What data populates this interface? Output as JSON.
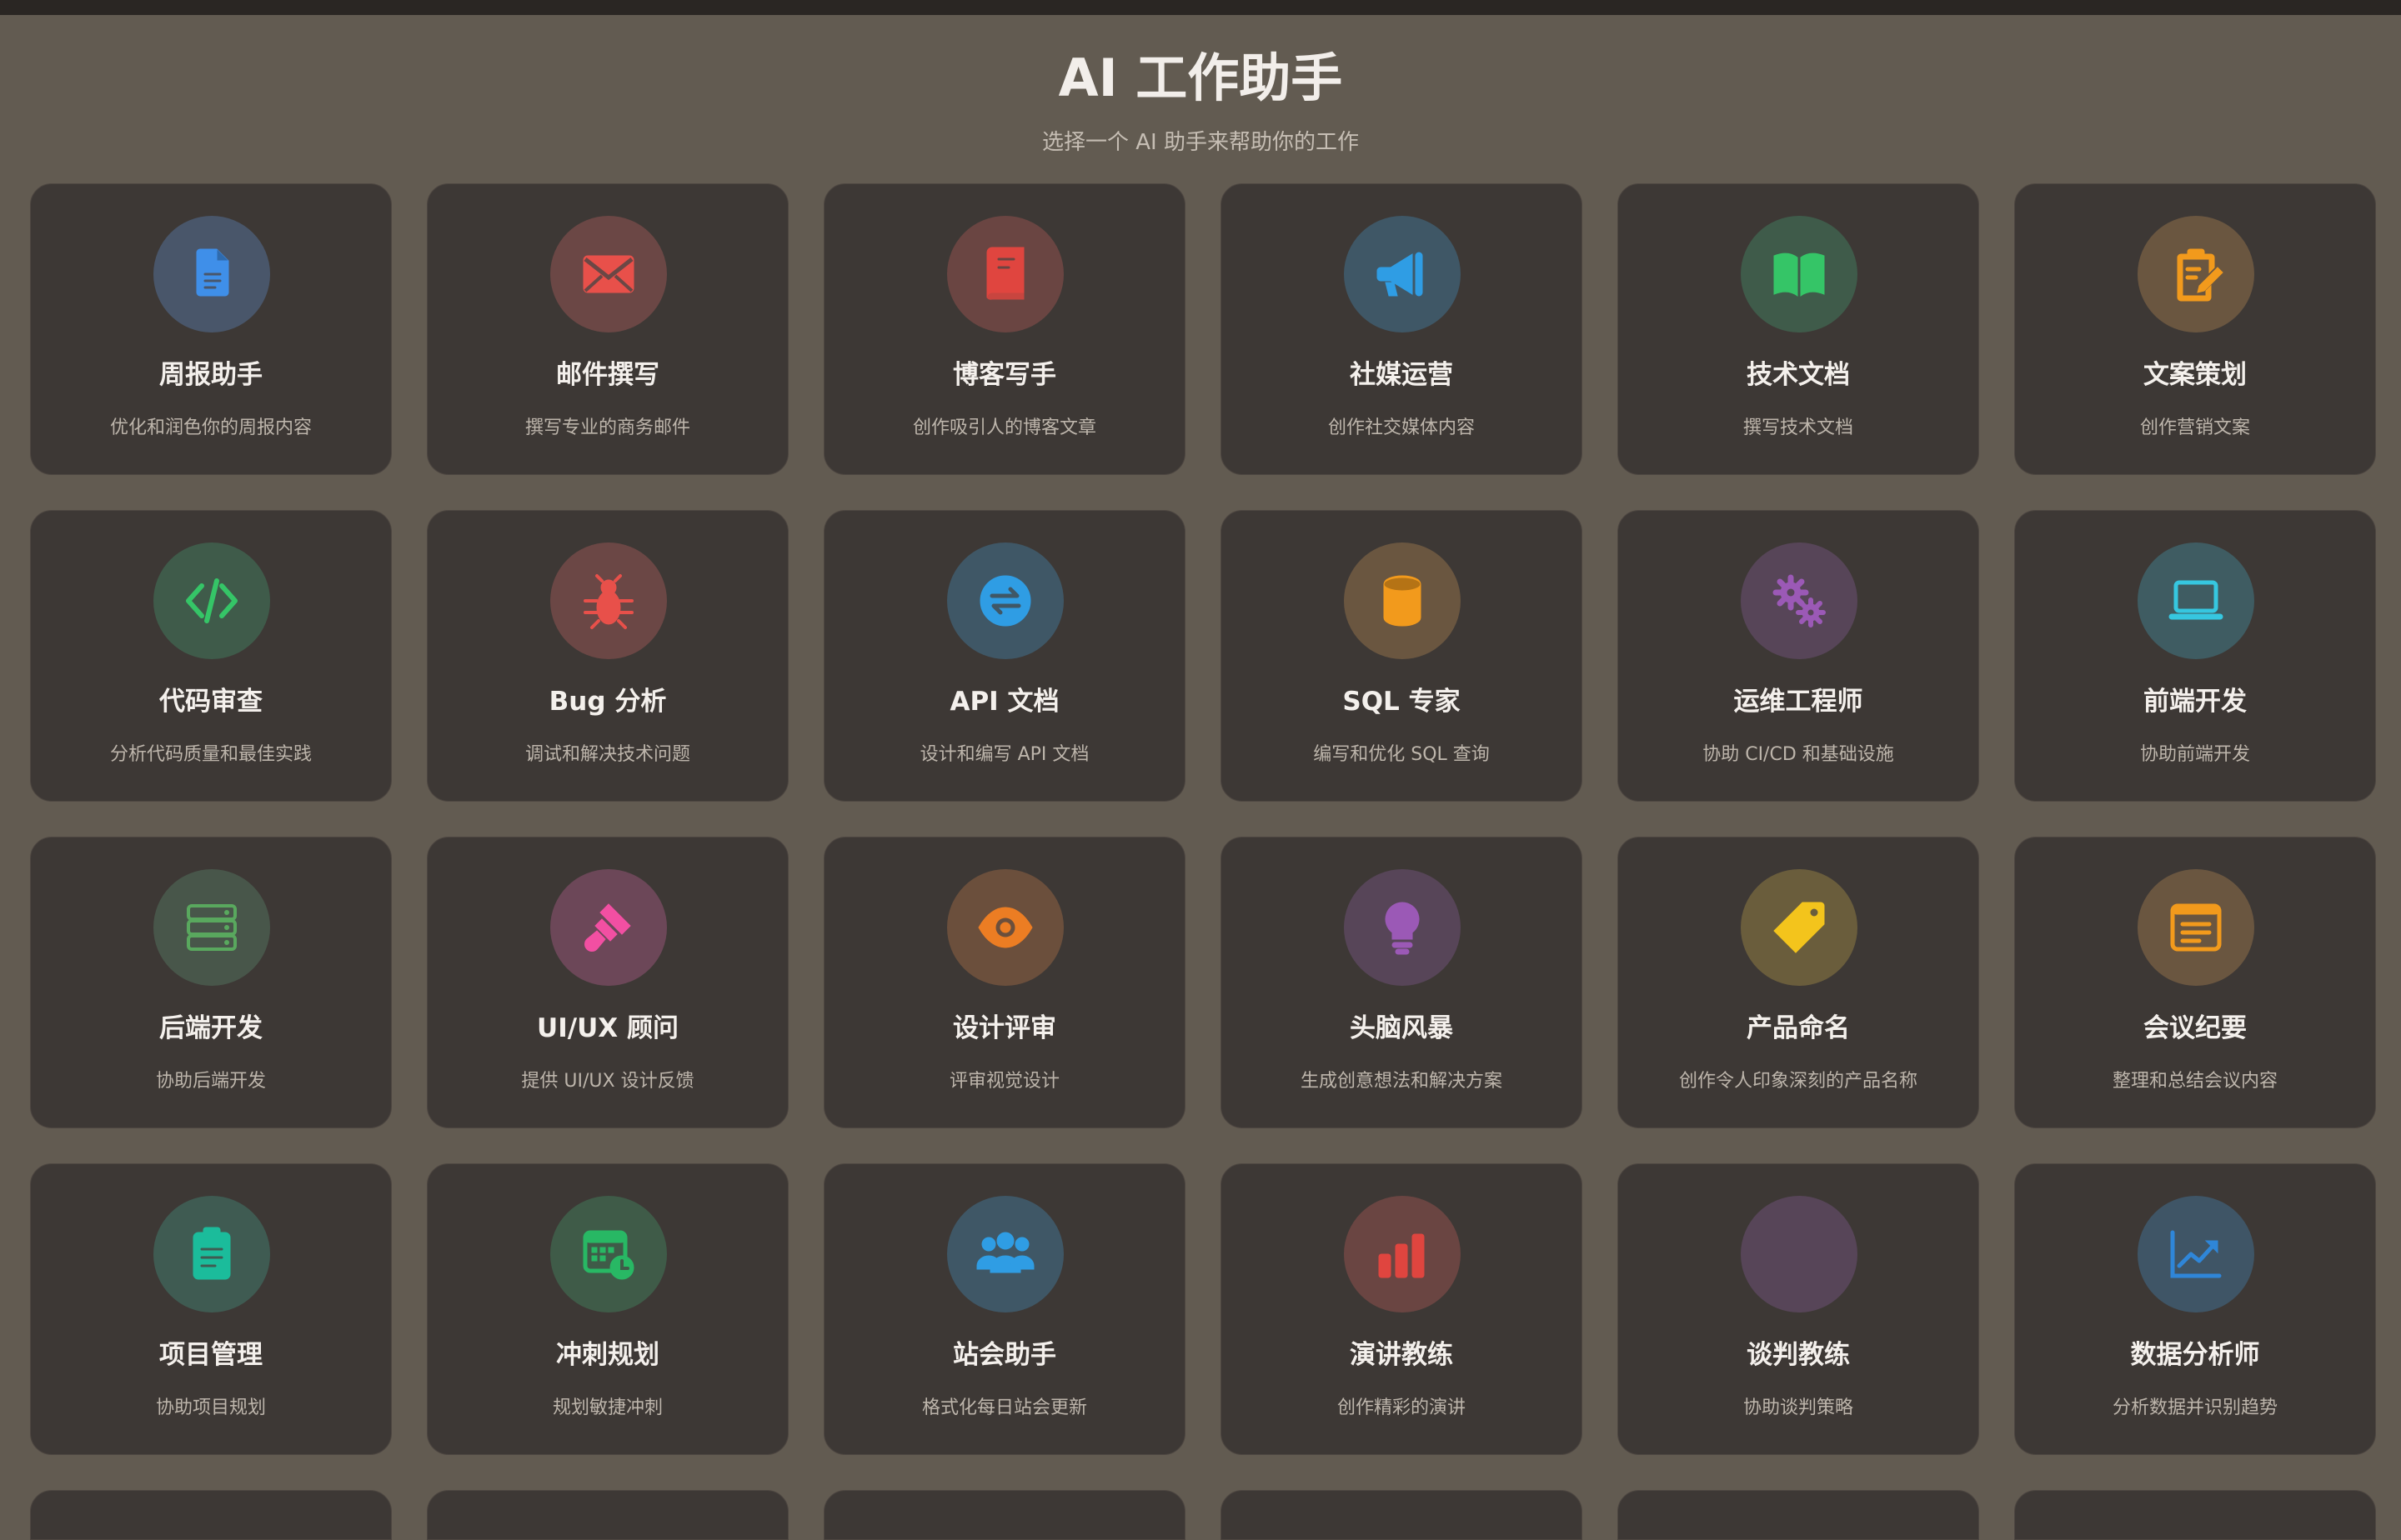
{
  "header": {
    "title": "AI 工作助手",
    "subtitle": "选择一个 AI 助手来帮助你的工作"
  },
  "cards": [
    {
      "title": "周报助手",
      "desc": "优化和润色你的周报内容",
      "icon": "document-icon",
      "color": "#3f8fe9",
      "bg": "#49566a"
    },
    {
      "title": "邮件撰写",
      "desc": "撰写专业的商务邮件",
      "icon": "envelope-icon",
      "color": "#e8504a",
      "bg": "#6b4745"
    },
    {
      "title": "博客写手",
      "desc": "创作吸引人的博客文章",
      "icon": "book-icon",
      "color": "#e0453f",
      "bg": "#6a4542"
    },
    {
      "title": "社媒运营",
      "desc": "创作社交媒体内容",
      "icon": "megaphone-icon",
      "color": "#2f9de4",
      "bg": "#3f5766"
    },
    {
      "title": "技术文档",
      "desc": "撰写技术文档",
      "icon": "open-book-icon",
      "color": "#35c567",
      "bg": "#3f5b4a"
    },
    {
      "title": "文案策划",
      "desc": "创作营销文案",
      "icon": "clipboard-pen-icon",
      "color": "#f29a1c",
      "bg": "#6a5640"
    },
    {
      "title": "代码审查",
      "desc": "分析代码质量和最佳实践",
      "icon": "code-icon",
      "color": "#35c567",
      "bg": "#3f5b4a"
    },
    {
      "title": "Bug 分析",
      "desc": "调试和解决技术问题",
      "icon": "bug-icon",
      "color": "#e8504a",
      "bg": "#6b4745"
    },
    {
      "title": "API 文档",
      "desc": "设计和编写 API 文档",
      "icon": "exchange-icon",
      "color": "#2f9de4",
      "bg": "#3f5766"
    },
    {
      "title": "SQL 专家",
      "desc": "编写和优化 SQL 查询",
      "icon": "database-icon",
      "color": "#f29a1c",
      "bg": "#6a5640"
    },
    {
      "title": "运维工程师",
      "desc": "协助 CI/CD 和基础设施",
      "icon": "gears-icon",
      "color": "#9b59b6",
      "bg": "#574558"
    },
    {
      "title": "前端开发",
      "desc": "协助前端开发",
      "icon": "laptop-icon",
      "color": "#36c7e0",
      "bg": "#3f5c62"
    },
    {
      "title": "后端开发",
      "desc": "协助后端开发",
      "icon": "server-icon",
      "color": "#59a85e",
      "bg": "#48564a"
    },
    {
      "title": "UI/UX 顾问",
      "desc": "提供 UI/UX 设计反馈",
      "icon": "paintbrush-icon",
      "color": "#f24fa2",
      "bg": "#6c4758"
    },
    {
      "title": "设计评审",
      "desc": "评审视觉设计",
      "icon": "eye-icon",
      "color": "#ec7d23",
      "bg": "#6b4f3c"
    },
    {
      "title": "头脑风暴",
      "desc": "生成创意想法和解决方案",
      "icon": "lightbulb-icon",
      "color": "#9b59b6",
      "bg": "#574558"
    },
    {
      "title": "产品命名",
      "desc": "创作令人印象深刻的产品名称",
      "icon": "tag-icon",
      "color": "#f3c41c",
      "bg": "#6a5d3c"
    },
    {
      "title": "会议纪要",
      "desc": "整理和总结会议内容",
      "icon": "note-icon",
      "color": "#f29a1c",
      "bg": "#6a5640"
    },
    {
      "title": "项目管理",
      "desc": "协助项目规划",
      "icon": "clipboard-list-icon",
      "color": "#1bbc9b",
      "bg": "#3f5b52"
    },
    {
      "title": "冲刺规划",
      "desc": "规划敏捷冲刺",
      "icon": "calendar-clock-icon",
      "color": "#28b864",
      "bg": "#3f5b48"
    },
    {
      "title": "站会助手",
      "desc": "格式化每日站会更新",
      "icon": "users-icon",
      "color": "#2f9de4",
      "bg": "#3f5766"
    },
    {
      "title": "演讲教练",
      "desc": "创作精彩的演讲",
      "icon": "bar-chart-icon",
      "color": "#e0453f",
      "bg": "#6a4542"
    },
    {
      "title": "谈判教练",
      "desc": "协助谈判策略",
      "icon": "blank-icon",
      "color": "#9b59b6",
      "bg": "#574558"
    },
    {
      "title": "数据分析师",
      "desc": "分析数据并识别趋势",
      "icon": "chart-line-icon",
      "color": "#2f86d8",
      "bg": "#3f5566"
    }
  ]
}
